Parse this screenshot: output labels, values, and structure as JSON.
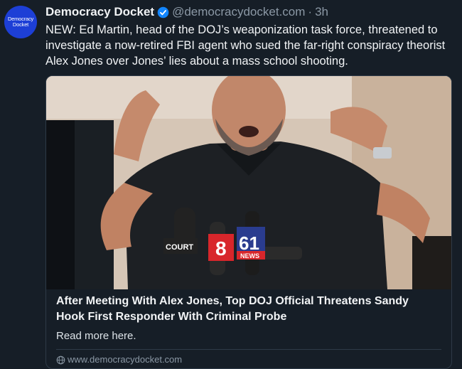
{
  "author": {
    "avatar_text_1": "Democracy",
    "avatar_text_2": "Docket",
    "name": "Democracy Docket",
    "handle": "@democracydocket.com",
    "separator": "·",
    "time": "3h",
    "verified_icon": "verified-check-icon",
    "avatar_color": "#1d3fd6"
  },
  "post": {
    "text": "NEW: Ed Martin, head of the DOJ’s weaponization task force, threatened to investigate a now-retired FBI agent who sued the far-right conspiracy theorist Alex Jones over Jones’ lies about a mass school shooting."
  },
  "card": {
    "image_label_court": "COURT",
    "image_label_8": "8",
    "image_label_61": "61",
    "image_label_news": "NEWS",
    "title": "After Meeting With Alex Jones, Top DOJ Official Threatens Sandy Hook First Responder With Criminal Probe",
    "description": "Read more here.",
    "domain": "www.democracydocket.com",
    "domain_icon": "globe-icon"
  },
  "colors": {
    "background": "#161e27",
    "text": "#f1f3f5",
    "muted": "#8b98a5",
    "accent": "#1185fe"
  }
}
